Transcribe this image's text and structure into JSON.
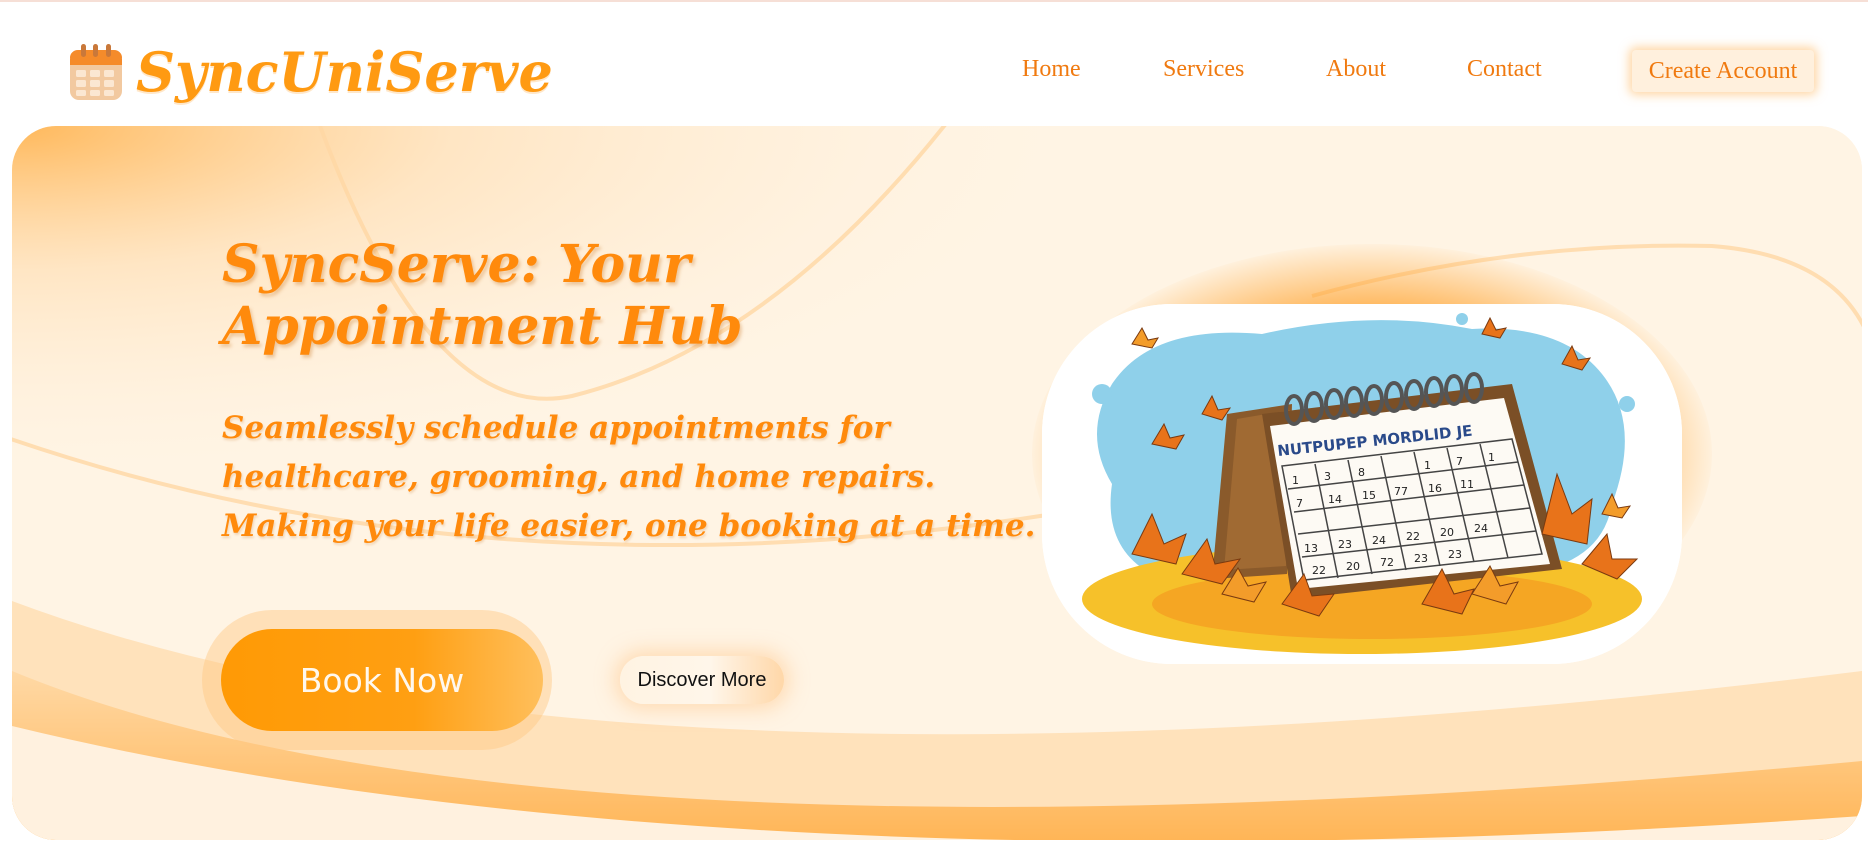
{
  "header": {
    "brand_name": "SyncUniServe",
    "logo_icon": "calendar-icon",
    "nav": [
      "Home",
      "Services",
      "About",
      "Contact"
    ],
    "create_account_label": "Create Account"
  },
  "hero": {
    "title": "SyncServe: Your Appointment Hub",
    "subtitle_line1": "Seamlessly schedule appointments for healthcare, grooming, and home repairs.",
    "subtitle_line2": "Making your life easier, one booking at a time.",
    "book_now_label": "Book Now",
    "discover_more_label": "Discover More",
    "illustration": {
      "icon": "desk-calendar-autumn-illustration",
      "header_text": "NUTPUPEP  MORDLID  JE",
      "dates": [
        "1",
        "3",
        "8",
        "1",
        "7",
        "1",
        "7",
        "14",
        "15",
        "77",
        "16",
        "11",
        "13",
        "23",
        "24",
        "22",
        "20",
        "24",
        "22",
        "20",
        "72",
        "23",
        "23"
      ]
    }
  },
  "colors": {
    "accent": "#ff9a12",
    "nav_text": "#f07a10",
    "hero_bg": "#fff3e2",
    "button": "#ff9a05"
  }
}
